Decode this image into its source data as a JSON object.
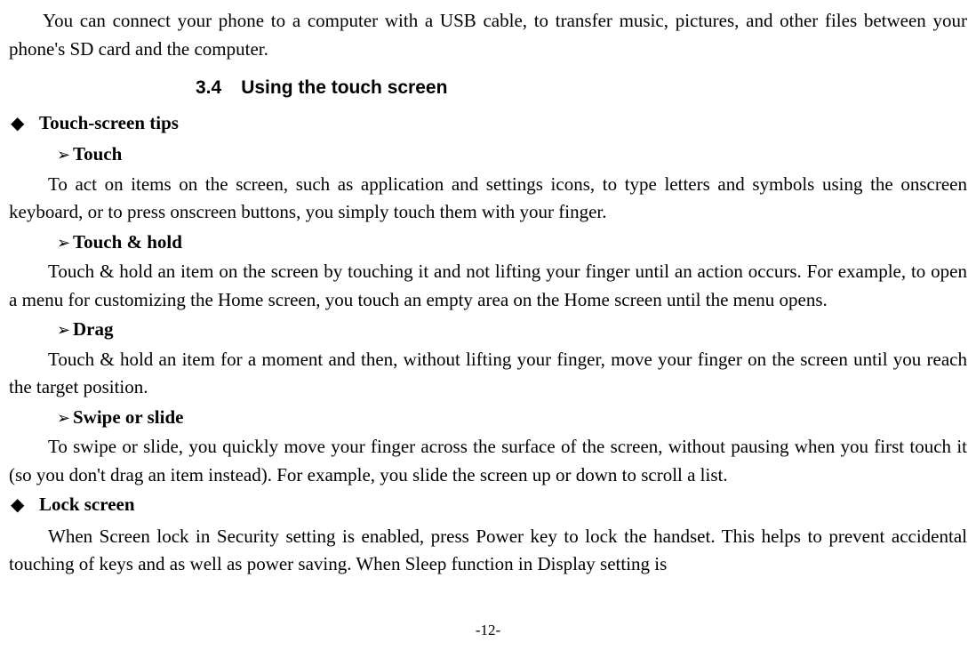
{
  "intro": "You can connect your phone to a computer with a USB cable, to transfer music, pictures, and other files between your phone's SD card and the computer.",
  "section": {
    "number": "3.4",
    "title": "Using the touch screen"
  },
  "tips": {
    "heading": "Touch-screen tips",
    "touch": {
      "label": "Touch",
      "body": "To act on items on the screen, such as application and settings icons, to type letters and symbols using the onscreen keyboard, or to press onscreen buttons, you simply touch them with your finger."
    },
    "touchhold": {
      "label": "Touch & hold",
      "body": "Touch & hold an item on the screen by touching it and not lifting your finger until an action occurs. For example, to open a menu for customizing the Home screen, you touch an empty area on the Home screen until the menu opens."
    },
    "drag": {
      "label": "Drag",
      "body": "Touch & hold an item for a moment and then, without lifting your finger, move your finger on the screen until you reach the target position."
    },
    "swipe": {
      "label": "Swipe or slide",
      "body": "To swipe or slide, you quickly move your finger across the surface of the screen, without pausing when you first touch it (so you don't drag an item instead). For example, you slide the screen up or down to scroll a list."
    }
  },
  "lock": {
    "heading": "Lock screen",
    "body": "When Screen lock in Security setting is enabled, press Power key to lock the handset. This helps to prevent accidental touching of keys and as well as power saving. When Sleep function in Display setting is"
  },
  "pageNumber": "-12-"
}
